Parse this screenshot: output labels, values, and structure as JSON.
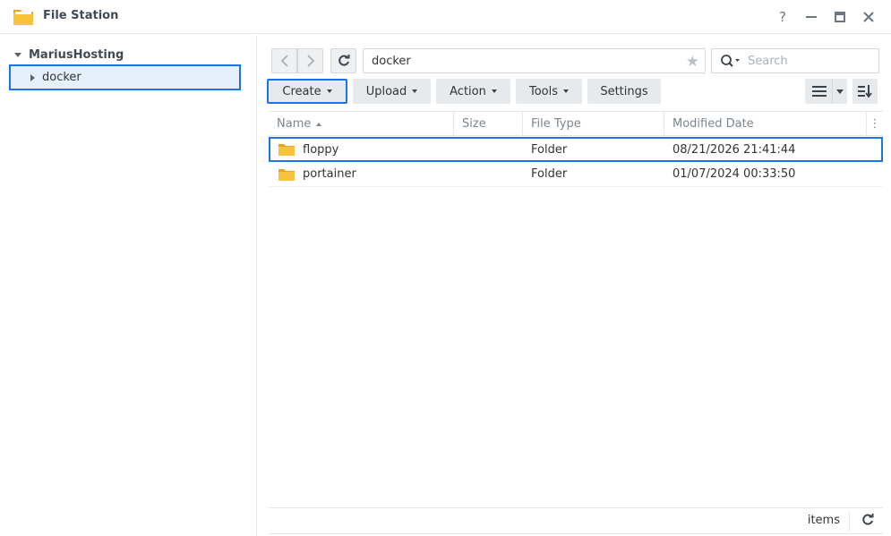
{
  "window": {
    "title": "File Station",
    "help": "?"
  },
  "sidebar": {
    "root_label": "MariusHosting",
    "items": [
      {
        "label": "docker"
      }
    ]
  },
  "location": {
    "path": "docker",
    "search_placeholder": "Search"
  },
  "toolbar": {
    "create": "Create",
    "upload": "Upload",
    "action": "Action",
    "tools": "Tools",
    "settings": "Settings"
  },
  "table": {
    "columns": {
      "name": "Name",
      "size": "Size",
      "type": "File Type",
      "modified": "Modified Date"
    },
    "rows": [
      {
        "name": "floppy",
        "size": "",
        "type": "Folder",
        "modified": "08/21/2026 21:41:44"
      },
      {
        "name": "portainer",
        "size": "",
        "type": "Folder",
        "modified": "01/07/2024 00:33:50"
      }
    ]
  },
  "status": {
    "items_label": "items"
  },
  "colors": {
    "accent": "#1a73e8",
    "folder": "#f5b82e"
  }
}
